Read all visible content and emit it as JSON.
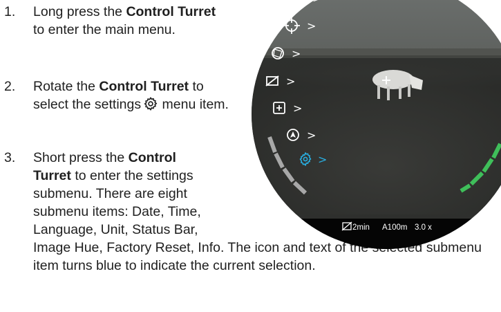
{
  "instructions": {
    "steps": [
      {
        "number": "1.",
        "parts": [
          "Long press the ",
          "Control Turret",
          " to enter the main menu."
        ]
      },
      {
        "number": "2.",
        "parts": [
          "Rotate the ",
          "Control Turret",
          " to select the settings",
          " menu item."
        ]
      },
      {
        "number": "3.",
        "parts": [
          "Short press the ",
          "Control Turret",
          " to enter the settings submenu. There are eight submenu items: Date, Time, Language, Unit, Status Bar, Image Hue, Factory Reset, Info. The icon and text of the selected submenu item turns blue to indicate the current selection."
        ]
      }
    ]
  },
  "device_screen": {
    "menu_icons": [
      "brightness-icon",
      "reticle-icon",
      "aperture-icon",
      "display-off-icon",
      "zoom-box-icon",
      "compass-icon",
      "settings-gear-icon"
    ],
    "selected_item": "settings-gear-icon",
    "colors": {
      "selected": "#29aee0",
      "normal": "#ffffff",
      "right_bar": "#3fbf5a"
    },
    "status_bar": {
      "sleep_timer": "2min",
      "distance": "A100m",
      "zoom": "3.0 x"
    }
  }
}
